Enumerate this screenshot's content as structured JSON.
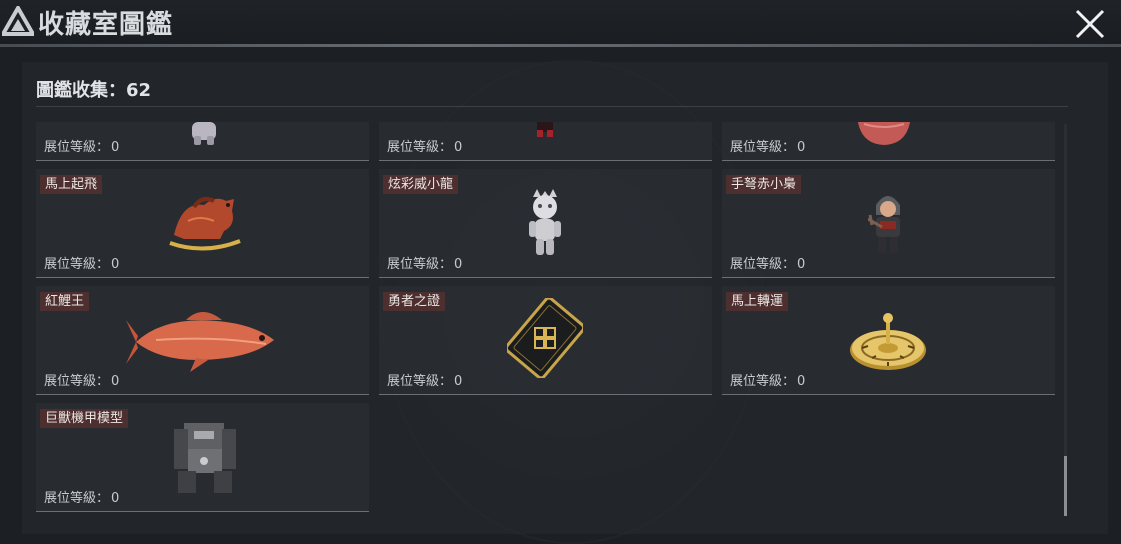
{
  "header": {
    "title": "收藏室圖鑑"
  },
  "collection": {
    "label": "圖鑑收集：62"
  },
  "level_label": "展位等級：",
  "items": [
    {
      "name": "",
      "level": "0",
      "icon": "bear-figure-icon"
    },
    {
      "name": "",
      "level": "0",
      "icon": "small-figure-icon"
    },
    {
      "name": "",
      "level": "0",
      "icon": "red-bowl-icon"
    },
    {
      "name": "馬上起飛",
      "level": "0",
      "icon": "rocking-horse-icon"
    },
    {
      "name": "炫彩威小龍",
      "level": "0",
      "icon": "dragon-doll-icon"
    },
    {
      "name": "手弩赤小梟",
      "level": "0",
      "icon": "crossbow-figure-icon"
    },
    {
      "name": "紅鯉王",
      "level": "0",
      "icon": "red-carp-icon"
    },
    {
      "name": "勇者之證",
      "level": "0",
      "icon": "brave-card-icon"
    },
    {
      "name": "馬上轉運",
      "level": "0",
      "icon": "golden-wheel-icon"
    },
    {
      "name": "巨獸機甲模型",
      "level": "0",
      "icon": "mech-model-icon"
    }
  ],
  "colors": {
    "name_tag_bg": "#4d2f2f",
    "background": "#1c2024"
  }
}
